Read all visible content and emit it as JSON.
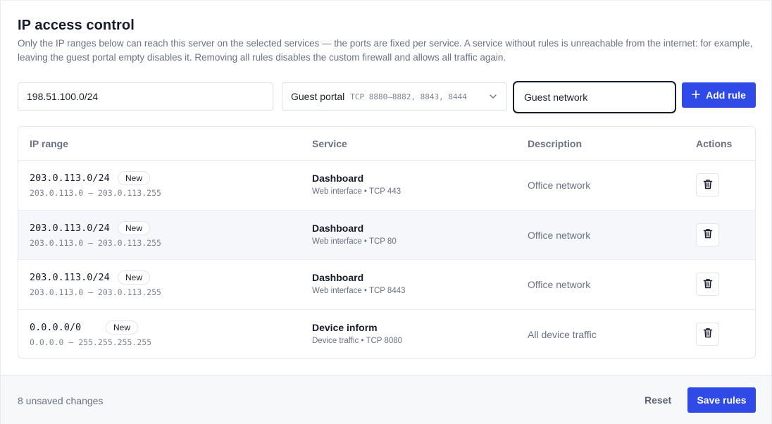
{
  "header": {
    "title": "IP access control",
    "description": "Only the IP ranges below can reach this server on the selected services — the ports are fixed per service. A service without rules is unreachable from the internet: for example, leaving the guest portal empty disables it. Removing all rules disables the custom firewall and allows all traffic again."
  },
  "form": {
    "ip_value": "198.51.100.0/24",
    "service_label": "Guest portal",
    "service_ports": "TCP 8880–8882, 8843, 8444",
    "description_value": "Guest network",
    "add_label": "Add rule"
  },
  "table": {
    "headers": {
      "ip": "IP range",
      "service": "Service",
      "description": "Description",
      "actions": "Actions"
    },
    "rows": [
      {
        "cidr": "203.0.113.0/24",
        "badge": "New",
        "range": "203.0.113.0 – 203.0.113.255",
        "service": "Dashboard",
        "detail": "Web interface • TCP 443",
        "description": "Office network"
      },
      {
        "cidr": "203.0.113.0/24",
        "badge": "New",
        "range": "203.0.113.0 – 203.0.113.255",
        "service": "Dashboard",
        "detail": "Web interface • TCP 80",
        "description": "Office network"
      },
      {
        "cidr": "203.0.113.0/24",
        "badge": "New",
        "range": "203.0.113.0 – 203.0.113.255",
        "service": "Dashboard",
        "detail": "Web interface • TCP 8443",
        "description": "Office network"
      },
      {
        "cidr": "0.0.0.0/0",
        "badge": "New",
        "range": "0.0.0.0 – 255.255.255.255",
        "service": "Device inform",
        "detail": "Device traffic • TCP 8080",
        "description": "All device traffic"
      }
    ]
  },
  "footer": {
    "status": "8 unsaved changes",
    "reset_label": "Reset",
    "save_label": "Save rules"
  },
  "icons": {
    "add": "plus-icon",
    "select": "chevron-down-icon",
    "delete": "trash-icon"
  },
  "colors": {
    "primary": "#2f4ae6",
    "text": "#151b29",
    "muted": "#6a7285",
    "row_alt": "#f5f7fa"
  }
}
